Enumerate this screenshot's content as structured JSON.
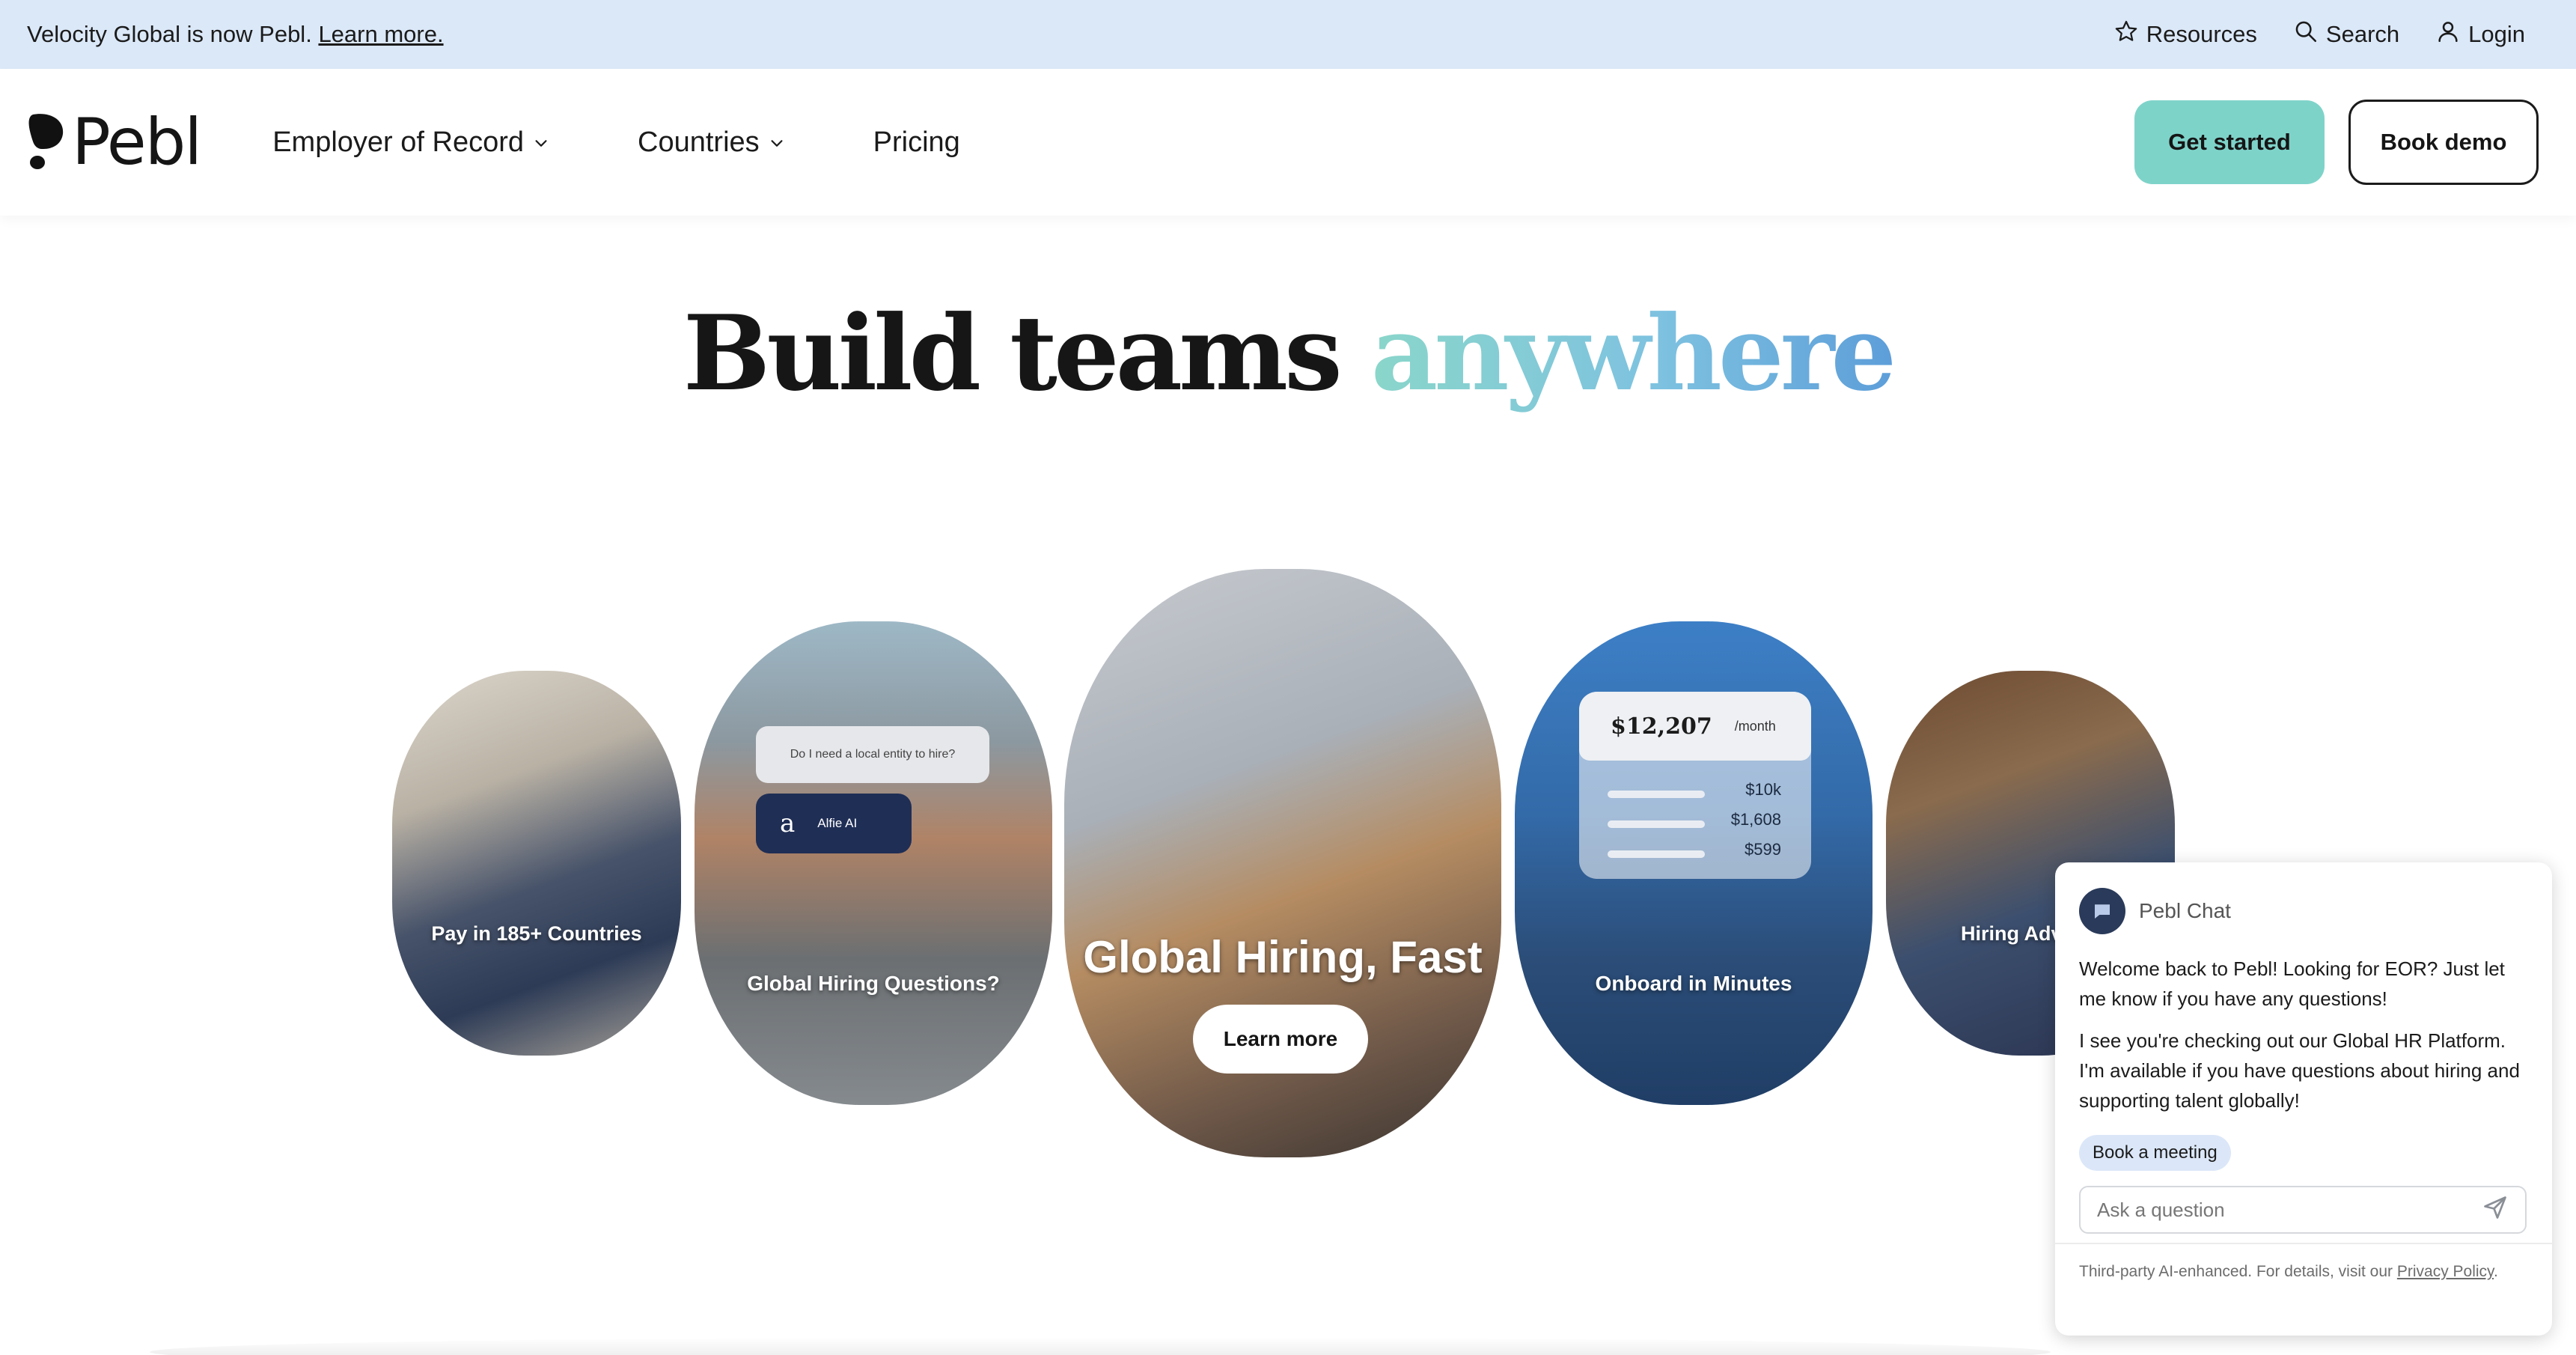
{
  "announcement": {
    "text": "Velocity Global is now Pebl.",
    "link": "Learn more.",
    "resources": "Resources",
    "search": "Search",
    "login": "Login"
  },
  "header": {
    "logo": "Pebl",
    "nav": [
      "Employer of Record",
      "Countries",
      "Pricing"
    ],
    "get_started": "Get started",
    "book_demo": "Book demo"
  },
  "hero": {
    "title_main": "Build teams",
    "title_accent": "anywhere"
  },
  "cards": {
    "pay": "Pay in 185+ Countries",
    "hiring_questions": "Global Hiring Questions?",
    "hiring_q_bubble": "Do I need a local entity to hire?",
    "alfie": "Alfie AI",
    "alfie_mark": "a",
    "featured": "Global Hiring, Fast",
    "learn_more": "Learn more",
    "onboard": "Onboard in Minutes",
    "price_amount": "$12,207",
    "price_period": "/month",
    "price_rows": [
      "$10k",
      "$1,608",
      "$599"
    ],
    "hiring_partial": "Hiring Adv"
  },
  "chat": {
    "title": "Pebl Chat",
    "msg1": "Welcome back to Pebl! Looking for EOR? Just let me know if you have any questions!",
    "msg2": "I see you're checking out our Global HR Platform. I'm available if you have questions about hiring and supporting talent globally!",
    "chip": "Book a meeting",
    "input_placeholder": "Ask a question",
    "footer_text": "Third-party AI-enhanced. For details, visit our",
    "footer_link": "Privacy Policy",
    "footer_end": "."
  },
  "colors": {
    "announcement_bg": "#dbe8f8",
    "primary_button": "#7ed3c9",
    "accent_gradient_start": "#8ad6ca",
    "accent_gradient_end": "#5d9ed9"
  }
}
